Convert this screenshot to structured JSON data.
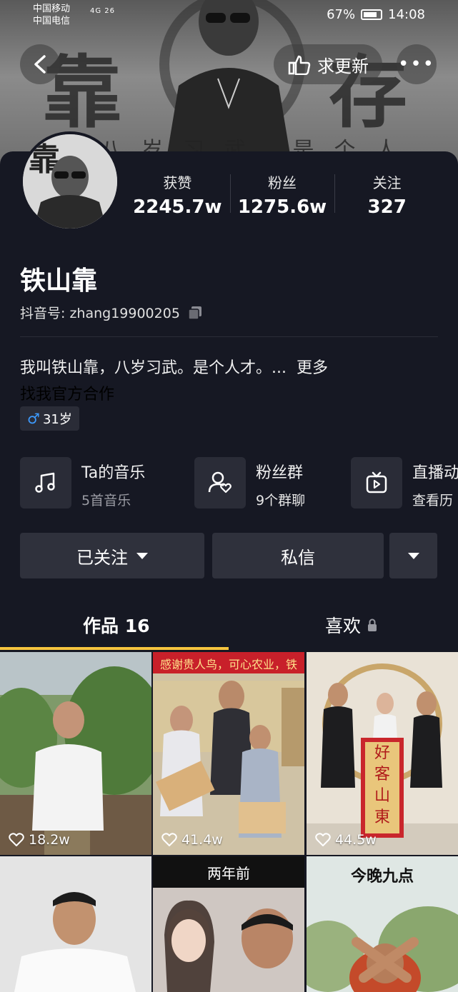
{
  "status_bar": {
    "carrier1": "中国移动",
    "carrier2": "中国电信",
    "signal": "4G 26",
    "battery": "67%",
    "time": "14:08"
  },
  "banner": {
    "chars": [
      "靠",
      "存"
    ],
    "subtitle": "八岁习武 是个人才"
  },
  "header": {
    "update_label": "求更新",
    "more_label": "•••"
  },
  "profile": {
    "stats": [
      {
        "label": "获赞",
        "value": "2245.7w"
      },
      {
        "label": "粉丝",
        "value": "1275.6w"
      },
      {
        "label": "关注",
        "value": "327"
      }
    ],
    "name": "铁山靠",
    "douyin_id_label": "抖音号: zhang19900205",
    "bio": "我叫铁山靠，八岁习武。是个人才。...",
    "bio_more": "更多",
    "cooperation": "找我官方合作",
    "gender_symbol": "♂",
    "age": "31岁"
  },
  "features": [
    {
      "title": "Ta的音乐",
      "sub": "5首音乐",
      "icon": "music-note-icon"
    },
    {
      "title": "粉丝群",
      "sub": "9个群聊",
      "icon": "fan-group-icon"
    },
    {
      "title": "直播动",
      "sub": "查看历",
      "icon": "tv-icon"
    }
  ],
  "actions": {
    "followed": "已关注",
    "message": "私信"
  },
  "tabs": {
    "works": "作品 16",
    "likes": "喜欢"
  },
  "videos": [
    {
      "likes": "18.2w",
      "banner_text": ""
    },
    {
      "likes": "41.4w",
      "banner_text": "感谢贵人鸟，可心农业，铁"
    },
    {
      "likes": "44.5w",
      "banner_text": "",
      "scroll_text": "好客山東"
    },
    {
      "likes": "",
      "banner_text": ""
    },
    {
      "likes": "",
      "banner_text": "两年前"
    },
    {
      "likes": "",
      "banner_text": "今晚九点"
    }
  ],
  "colors": {
    "background": "#161823",
    "accent": "#f6c53e",
    "button": "#2f313c"
  }
}
